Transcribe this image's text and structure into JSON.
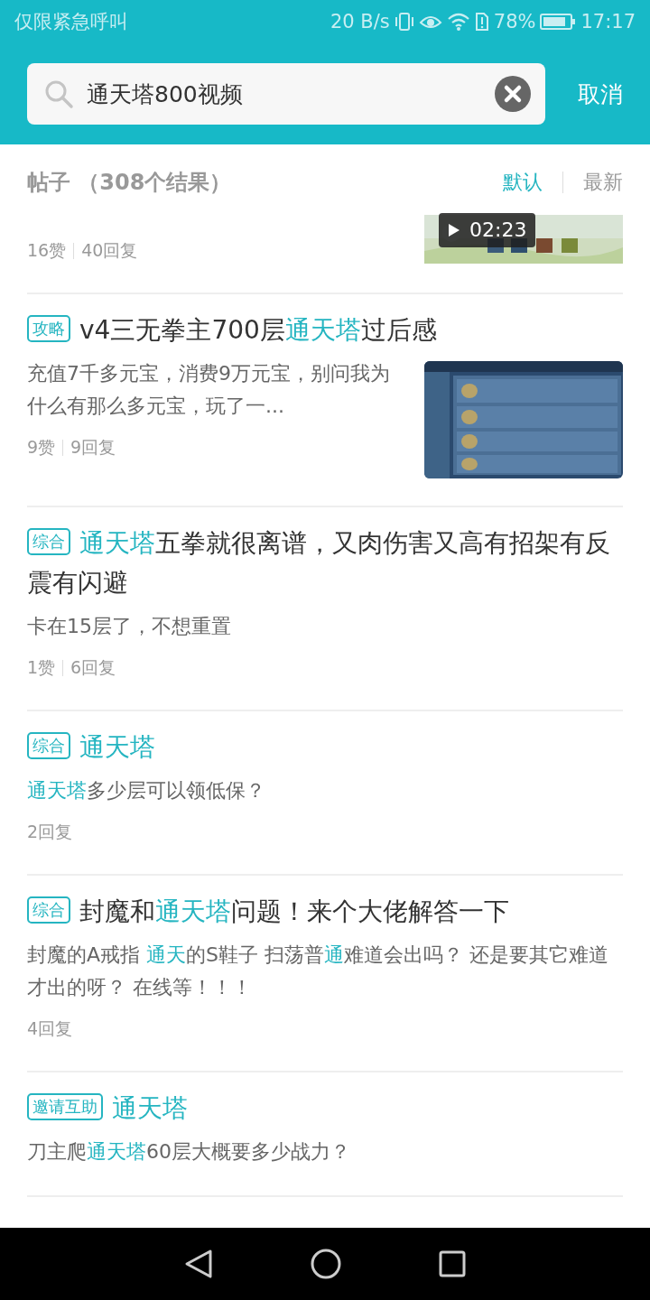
{
  "status_bar": {
    "carrier": "仅限紧急呼叫",
    "speed": "20 B/s",
    "battery": "78%",
    "time": "17:17"
  },
  "search": {
    "value": "通天塔800视频",
    "cancel": "取消"
  },
  "results_header": {
    "title": "帖子 （308个结果）",
    "sorts": [
      {
        "label": "默认",
        "selected": true
      },
      {
        "label": "最新",
        "selected": false
      }
    ]
  },
  "posts": [
    {
      "stats": [
        "16赞",
        "40回复"
      ],
      "thumbnail": {
        "kind": "picture",
        "duration": "02:23",
        "partial": true
      }
    },
    {
      "tag": "攻略",
      "title": [
        {
          "text": "v4三无拳主700层",
          "highlight": false
        },
        {
          "text": "通天塔",
          "highlight": true
        },
        {
          "text": "过后感",
          "highlight": false
        }
      ],
      "body": [
        {
          "text": "充值7千多元宝，消费9万元宝，别问我为什么有那么多元宝，玩了一...",
          "highlight": false
        }
      ],
      "stats": [
        "9赞",
        "9回复"
      ],
      "thumbnail": {
        "kind": "picture",
        "partial": false
      }
    },
    {
      "tag": "综合",
      "title": [
        {
          "text": "通天塔",
          "highlight": true
        },
        {
          "text": "五拳就很离谱，又肉伤害又高有招架有反震有闪避",
          "highlight": false
        }
      ],
      "body": [
        {
          "text": "卡在15层了，不想重置",
          "highlight": false
        }
      ],
      "stats": [
        "1赞",
        "6回复"
      ]
    },
    {
      "tag": "综合",
      "title": [
        {
          "text": "通天塔",
          "highlight": true
        }
      ],
      "body": [
        {
          "text": "通天塔",
          "highlight": true
        },
        {
          "text": "多少层可以领低保？",
          "highlight": false
        }
      ],
      "stats": [
        "2回复"
      ]
    },
    {
      "tag": "综合",
      "title": [
        {
          "text": "封魔和",
          "highlight": false
        },
        {
          "text": "通天塔",
          "highlight": true
        },
        {
          "text": "问题！来个大佬解答一下",
          "highlight": false
        }
      ],
      "body": [
        {
          "text": "封魔的A戒指 ",
          "highlight": false
        },
        {
          "text": "通天",
          "highlight": true
        },
        {
          "text": "的S鞋子 扫荡普",
          "highlight": false
        },
        {
          "text": "通",
          "highlight": true
        },
        {
          "text": "难道会出吗？ 还是要其它难道才出的呀？ 在线等！！！",
          "highlight": false
        }
      ],
      "stats": [
        "4回复"
      ]
    },
    {
      "tag": "邀请互助",
      "title": [
        {
          "text": "通天塔",
          "highlight": true
        }
      ],
      "body": [
        {
          "text": "刀主爬",
          "highlight": false
        },
        {
          "text": "通天塔",
          "highlight": true
        },
        {
          "text": "60层大概要多少战力？",
          "highlight": false
        }
      ]
    }
  ]
}
